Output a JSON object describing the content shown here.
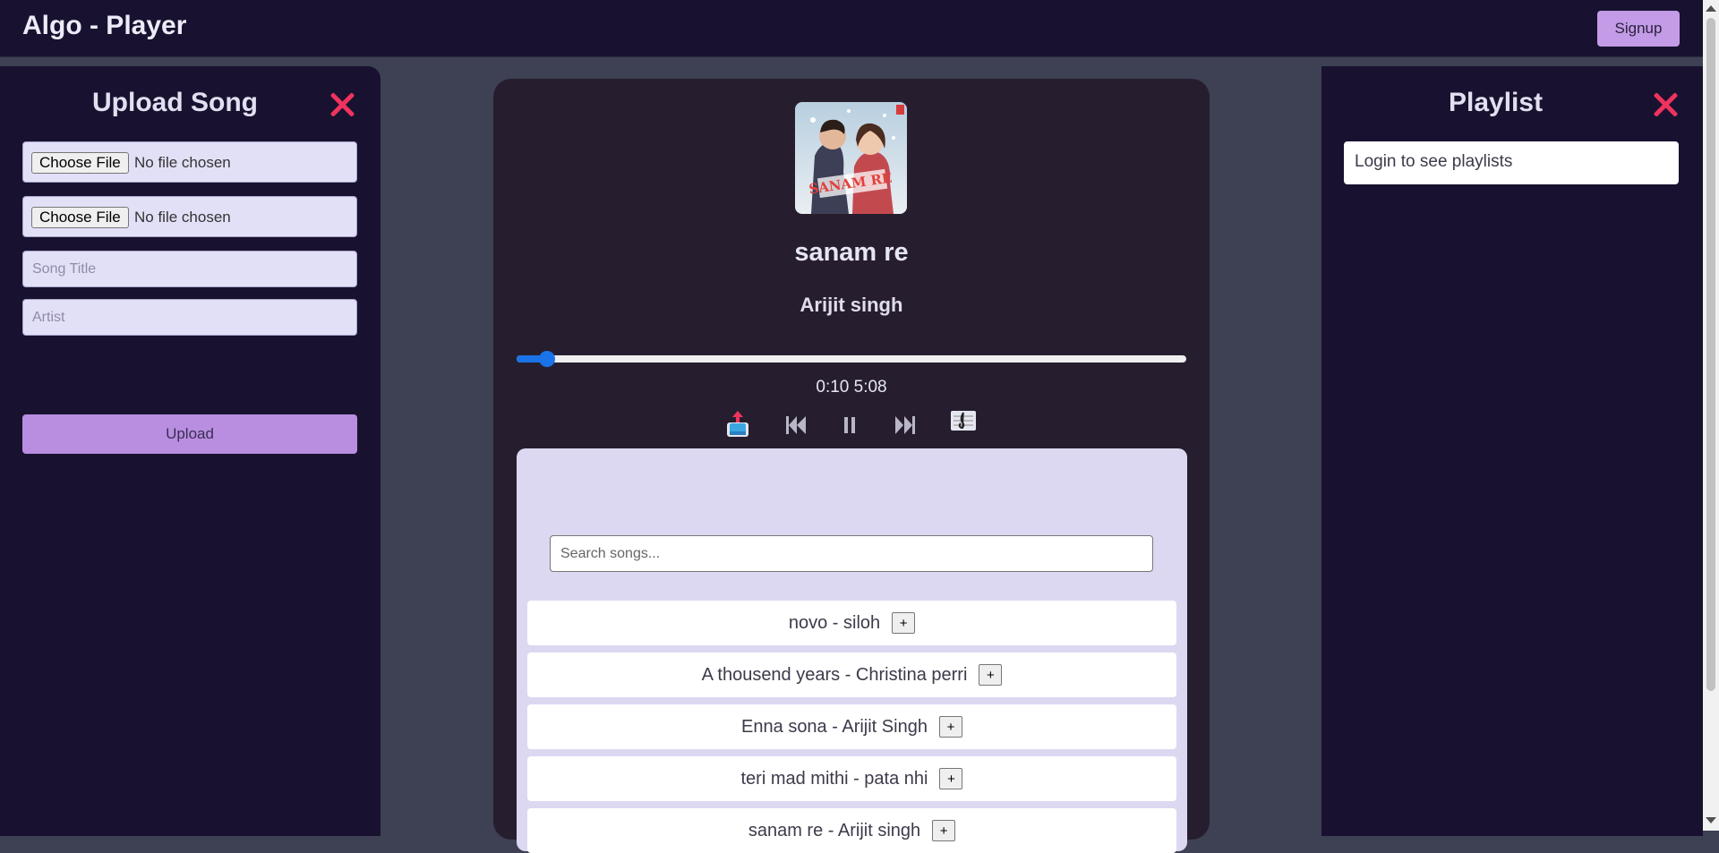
{
  "header": {
    "title": "Algo - Player",
    "signup_label": "Signup"
  },
  "upload": {
    "title": "Upload Song",
    "file_inputs": [
      {
        "button_label": "Choose File",
        "status": "No file chosen"
      },
      {
        "button_label": "Choose File",
        "status": "No file chosen"
      }
    ],
    "title_placeholder": "Song Title",
    "artist_placeholder": "Artist",
    "upload_label": "Upload"
  },
  "player": {
    "song_title": "sanam re",
    "artist": "Arijit singh",
    "cover_text": "SANAM RE",
    "current_time": "0:10",
    "duration": "5:08",
    "progress_fraction": 0.046,
    "search_placeholder": "Search songs...",
    "add_label": "+",
    "songs": [
      {
        "label": "novo - siloh"
      },
      {
        "label": "A thousend years - Christina perri"
      },
      {
        "label": "Enna sona - Arijit Singh"
      },
      {
        "label": "teri mad mithi - pata nhi"
      },
      {
        "label": "sanam re - Arijit singh"
      }
    ]
  },
  "playlist": {
    "title": "Playlist",
    "message": "Login to see playlists"
  },
  "colors": {
    "accent": "#c39be6",
    "close": "#f0335e",
    "progress": "#1a73e8"
  }
}
